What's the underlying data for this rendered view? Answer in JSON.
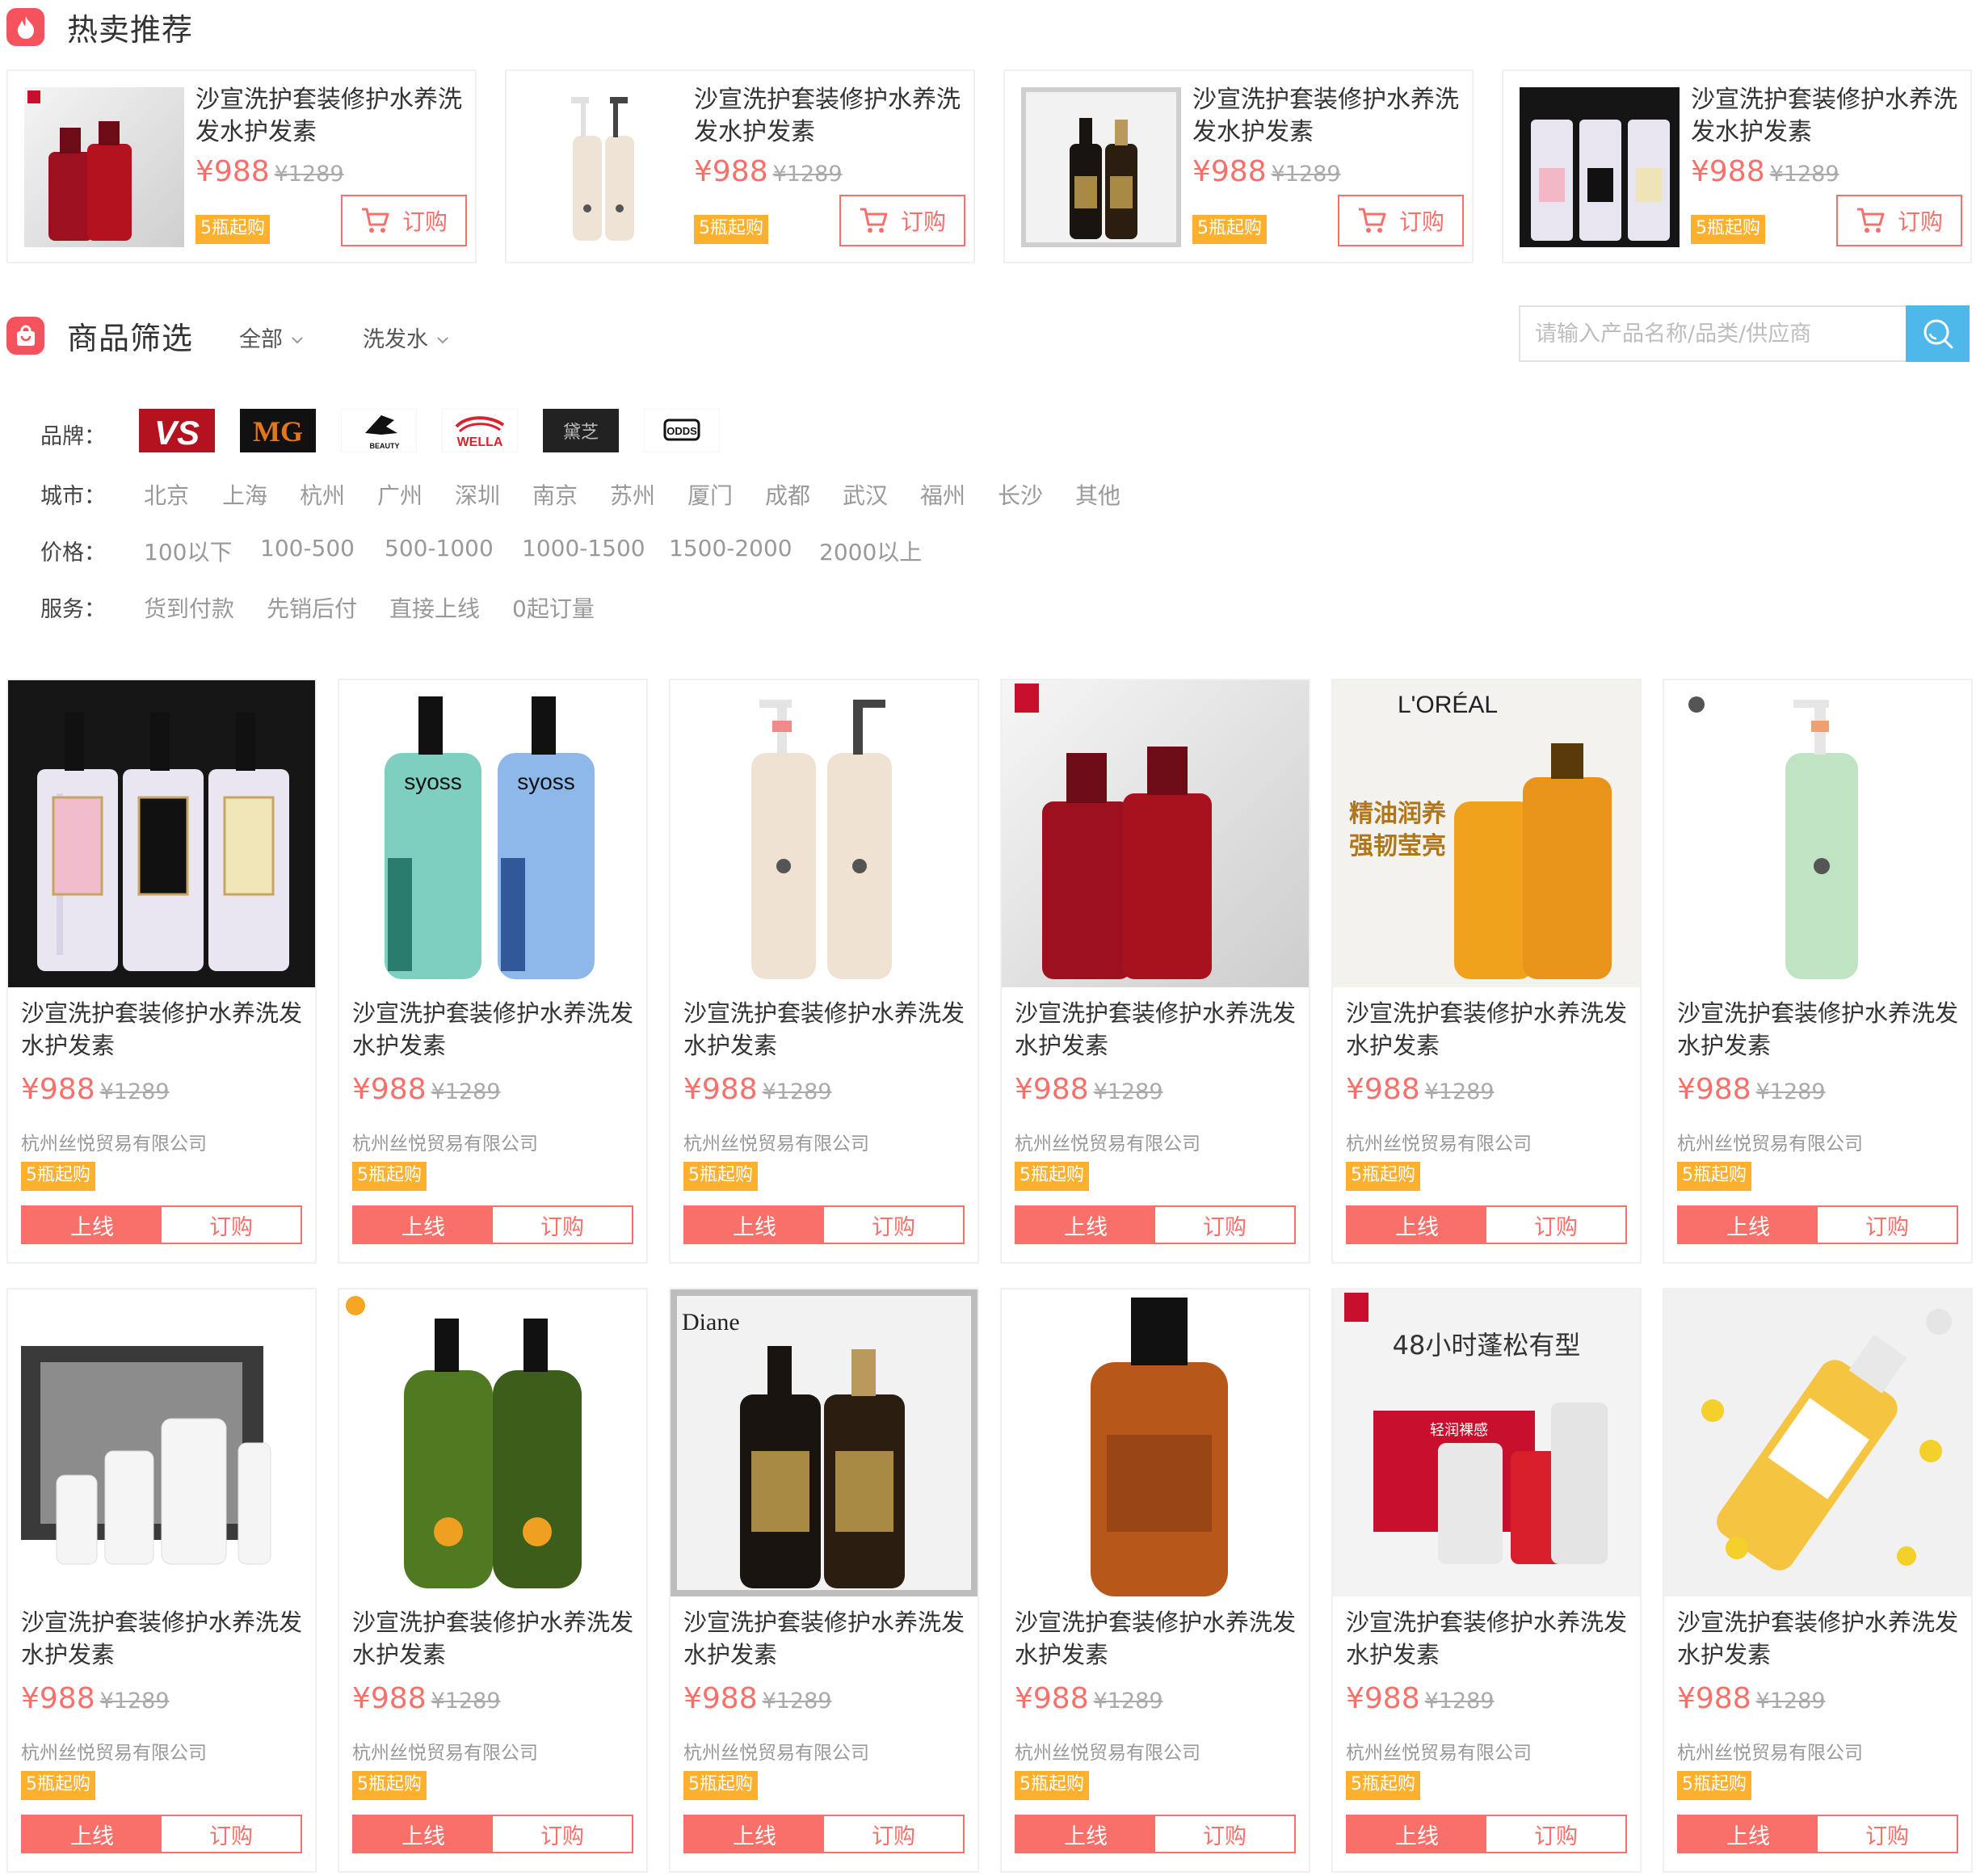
{
  "hot": {
    "title": "热卖推荐",
    "icon": "flame-icon",
    "items": [
      {
        "title": "沙宣洗护套装修护水养洗发水护发素",
        "price": "¥988",
        "old_price": "¥1289",
        "moq": "5瓶起购",
        "order": "订购"
      },
      {
        "title": "沙宣洗护套装修护水养洗发水护发素",
        "price": "¥988",
        "old_price": "¥1289",
        "moq": "5瓶起购",
        "order": "订购"
      },
      {
        "title": "沙宣洗护套装修护水养洗发水护发素",
        "price": "¥988",
        "old_price": "¥1289",
        "moq": "5瓶起购",
        "order": "订购"
      },
      {
        "title": "沙宣洗护套装修护水养洗发水护发素",
        "price": "¥988",
        "old_price": "¥1289",
        "moq": "5瓶起购",
        "order": "订购"
      }
    ]
  },
  "filter": {
    "title": "商品筛选",
    "icon": "shopping-bag-icon",
    "dropdown1": "全部",
    "dropdown2": "洗发水",
    "search_placeholder": "请输入产品名称/品类/供应商",
    "brand_label": "品牌：",
    "brands": [
      "VS",
      "MG",
      "BEAUTY",
      "WELLA",
      "黛芝",
      "ODDS"
    ],
    "city_label": "城市：",
    "cities": [
      "北京",
      "上海",
      "杭州",
      "广州",
      "深圳",
      "南京",
      "苏州",
      "厦门",
      "成都",
      "武汉",
      "福州",
      "长沙",
      "其他"
    ],
    "price_label": "价格：",
    "prices": [
      "100以下",
      "100-500",
      "500-1000",
      "1000-1500",
      "1500-2000",
      "2000以上"
    ],
    "service_label": "服务：",
    "services": [
      "货到付款",
      "先销后付",
      "直接上线",
      "0起订量"
    ]
  },
  "products": [
    {
      "title": "沙宣洗护套装修护水养洗发水护发素",
      "price": "¥988",
      "old_price": "¥1289",
      "company": "杭州丝悦贸易有限公司",
      "moq": "5瓶起购",
      "online": "上线",
      "order": "订购"
    },
    {
      "title": "沙宣洗护套装修护水养洗发水护发素",
      "price": "¥988",
      "old_price": "¥1289",
      "company": "杭州丝悦贸易有限公司",
      "moq": "5瓶起购",
      "online": "上线",
      "order": "订购"
    },
    {
      "title": "沙宣洗护套装修护水养洗发水护发素",
      "price": "¥988",
      "old_price": "¥1289",
      "company": "杭州丝悦贸易有限公司",
      "moq": "5瓶起购",
      "online": "上线",
      "order": "订购"
    },
    {
      "title": "沙宣洗护套装修护水养洗发水护发素",
      "price": "¥988",
      "old_price": "¥1289",
      "company": "杭州丝悦贸易有限公司",
      "moq": "5瓶起购",
      "online": "上线",
      "order": "订购"
    },
    {
      "title": "沙宣洗护套装修护水养洗发水护发素",
      "price": "¥988",
      "old_price": "¥1289",
      "company": "杭州丝悦贸易有限公司",
      "moq": "5瓶起购",
      "online": "上线",
      "order": "订购"
    },
    {
      "title": "沙宣洗护套装修护水养洗发水护发素",
      "price": "¥988",
      "old_price": "¥1289",
      "company": "杭州丝悦贸易有限公司",
      "moq": "5瓶起购",
      "online": "上线",
      "order": "订购"
    },
    {
      "title": "沙宣洗护套装修护水养洗发水护发素",
      "price": "¥988",
      "old_price": "¥1289",
      "company": "杭州丝悦贸易有限公司",
      "moq": "5瓶起购",
      "online": "上线",
      "order": "订购"
    },
    {
      "title": "沙宣洗护套装修护水养洗发水护发素",
      "price": "¥988",
      "old_price": "¥1289",
      "company": "杭州丝悦贸易有限公司",
      "moq": "5瓶起购",
      "online": "上线",
      "order": "订购"
    },
    {
      "title": "沙宣洗护套装修护水养洗发水护发素",
      "price": "¥988",
      "old_price": "¥1289",
      "company": "杭州丝悦贸易有限公司",
      "moq": "5瓶起购",
      "online": "上线",
      "order": "订购"
    },
    {
      "title": "沙宣洗护套装修护水养洗发水护发素",
      "price": "¥988",
      "old_price": "¥1289",
      "company": "杭州丝悦贸易有限公司",
      "moq": "5瓶起购",
      "online": "上线",
      "order": "订购"
    },
    {
      "title": "沙宣洗护套装修护水养洗发水护发素",
      "price": "¥988",
      "old_price": "¥1289",
      "company": "杭州丝悦贸易有限公司",
      "moq": "5瓶起购",
      "online": "上线",
      "order": "订购"
    },
    {
      "title": "沙宣洗护套装修护水养洗发水护发素",
      "price": "¥988",
      "old_price": "¥1289",
      "company": "杭州丝悦贸易有限公司",
      "moq": "5瓶起购",
      "online": "上线",
      "order": "订购"
    }
  ],
  "image_labels": {
    "img2_line1": "48小时蓬松有型",
    "img2_vs": "轻润裸感"
  },
  "colors": {
    "accent": "#f9706a",
    "icon_red": "#f4525c",
    "badge": "#fdb02d",
    "search_btn": "#4fb8ea"
  }
}
